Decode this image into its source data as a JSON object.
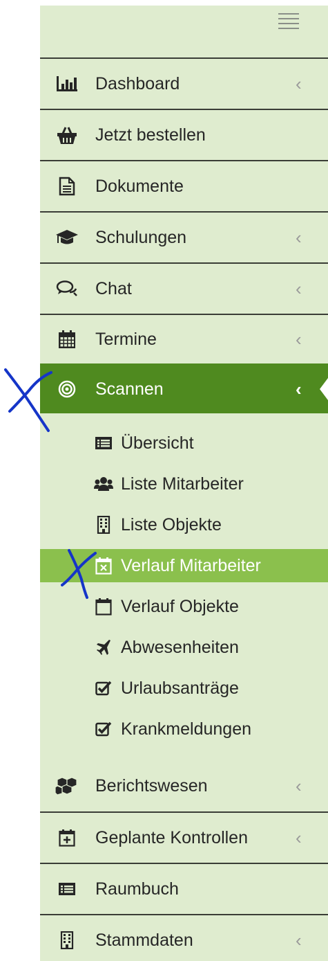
{
  "menu": [
    {
      "key": "dashboard",
      "label": "Dashboard",
      "icon": "bar-chart-icon",
      "has_submenu": true
    },
    {
      "key": "jetzt-bestellen",
      "label": "Jetzt bestellen",
      "icon": "basket-icon",
      "has_submenu": false
    },
    {
      "key": "dokumente",
      "label": "Dokumente",
      "icon": "document-icon",
      "has_submenu": false
    },
    {
      "key": "schulungen",
      "label": "Schulungen",
      "icon": "graduation-cap-icon",
      "has_submenu": true
    },
    {
      "key": "chat",
      "label": "Chat",
      "icon": "chat-bubbles-icon",
      "has_submenu": true
    },
    {
      "key": "termine",
      "label": "Termine",
      "icon": "calendar-icon",
      "has_submenu": true
    },
    {
      "key": "scannen",
      "label": "Scannen",
      "icon": "target-icon",
      "has_submenu": true,
      "active": true
    },
    {
      "key": "berichtswesen",
      "label": "Berichtswesen",
      "icon": "cubes-icon",
      "has_submenu": true
    },
    {
      "key": "geplante-kontrollen",
      "label": "Geplante Kontrollen",
      "icon": "calendar-plus-icon",
      "has_submenu": true
    },
    {
      "key": "raumbuch",
      "label": "Raumbuch",
      "icon": "list-card-icon",
      "has_submenu": false
    },
    {
      "key": "stammdaten",
      "label": "Stammdaten",
      "icon": "building-icon",
      "has_submenu": true
    }
  ],
  "submenu": [
    {
      "label": "Übersicht",
      "icon": "list-card-icon"
    },
    {
      "label": "Liste Mitarbeiter",
      "icon": "users-icon"
    },
    {
      "label": "Liste Objekte",
      "icon": "building-icon"
    },
    {
      "label": "Verlauf Mitarbeiter",
      "icon": "calendar-x-icon",
      "selected": true
    },
    {
      "label": "Verlauf Objekte",
      "icon": "calendar-empty-icon"
    },
    {
      "label": "Abwesenheiten",
      "icon": "plane-icon"
    },
    {
      "label": "Urlaubsanträge",
      "icon": "checkbox-icon"
    },
    {
      "label": "Krankmeldungen",
      "icon": "checkbox-icon"
    }
  ],
  "chevron": "‹",
  "colors": {
    "sidebar_bg": "#dfeccf",
    "active_bg": "#4f8a1f",
    "selected_bg": "#8bc04d",
    "divider": "#3a3d36",
    "annotation_ink": "#1535c8"
  }
}
